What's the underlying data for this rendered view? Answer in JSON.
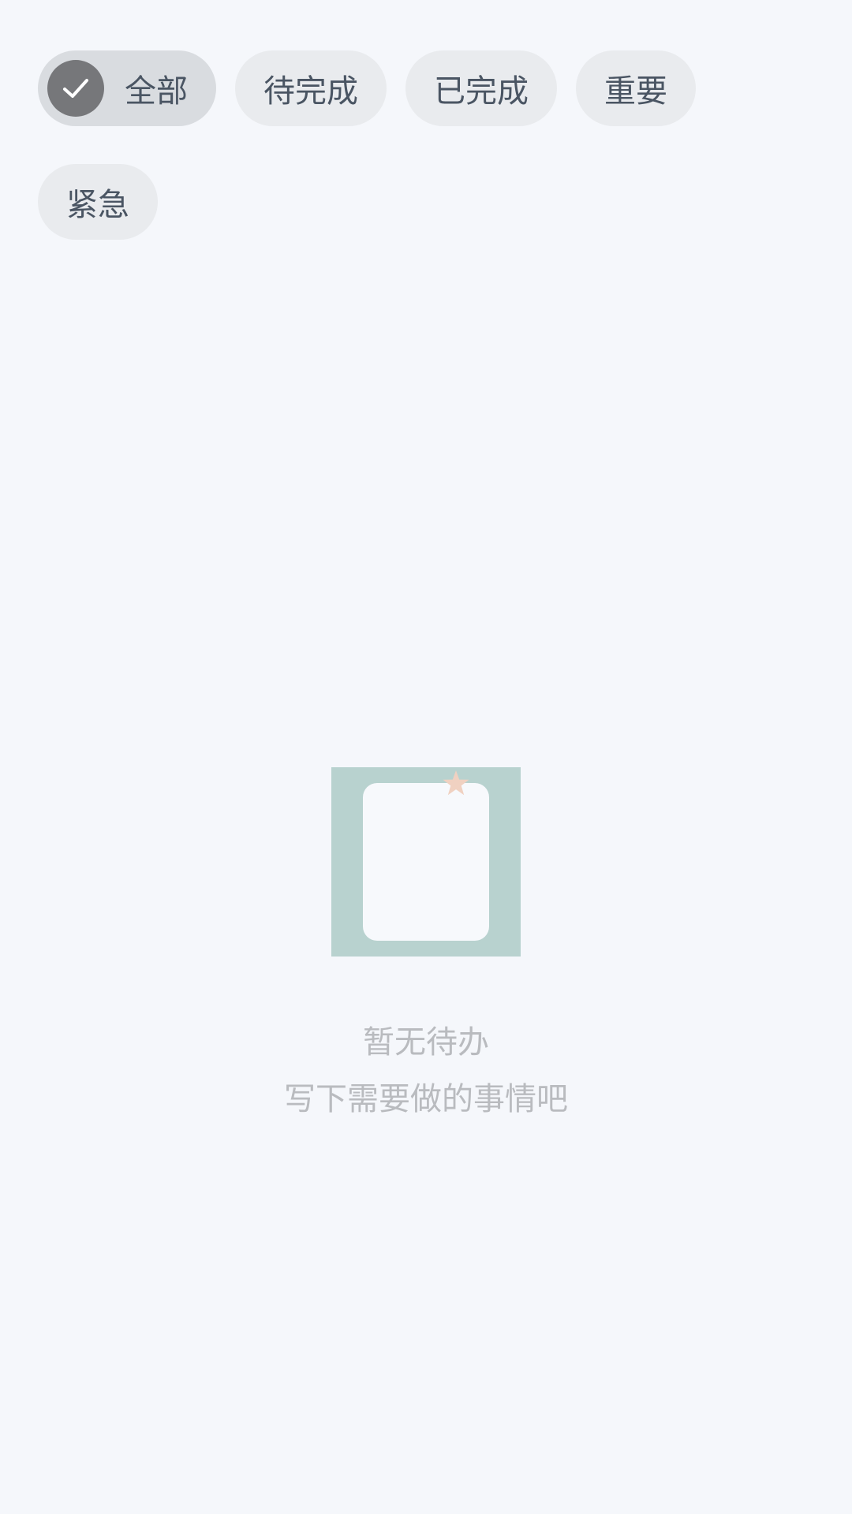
{
  "filters": {
    "all": "全部",
    "pending": "待完成",
    "done": "已完成",
    "important": "重要",
    "urgent": "紧急"
  },
  "empty_state": {
    "title": "暂无待办",
    "subtitle": "写下需要做的事情吧"
  },
  "icons": {
    "selected_check": "check-icon",
    "illustration": "empty-notes-illustration",
    "star": "star-icon"
  },
  "colors": {
    "page_background": "#f5f7fb",
    "chip_background": "#e9ebee",
    "chip_selected_background": "#d9dce0",
    "check_circle": "#76777a",
    "chip_text": "#4a5563",
    "illustration_background": "#b8d2cf",
    "star": "#f0d1c1",
    "empty_text": "#b9bbbf"
  }
}
